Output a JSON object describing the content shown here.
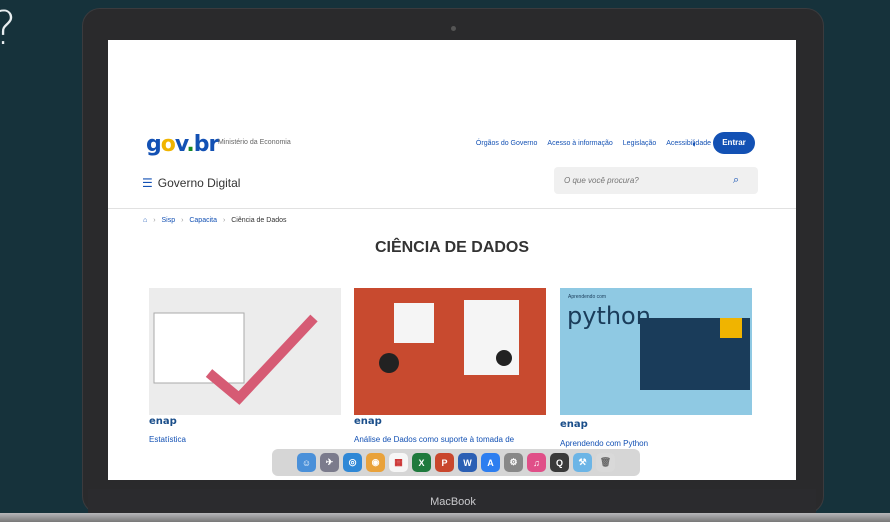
{
  "edge_text": "?\nl",
  "device": {
    "brand": "MacBook"
  },
  "header": {
    "logo": {
      "g": "g",
      "o": "o",
      "v": "v",
      "dot": ".",
      "br": "br"
    },
    "ministry": "Ministério da Economia",
    "links": [
      "Órgãos do Governo",
      "Acesso à informação",
      "Legislação",
      "Acessibilidade"
    ],
    "entrar": "Entrar",
    "menu_title": "Governo Digital",
    "search_placeholder": "O que você procura?"
  },
  "breadcrumb": [
    "Sisp",
    "Capacita",
    "Ciência de Dados"
  ],
  "page_title": "CIÊNCIA DE DADOS",
  "cards": [
    {
      "title": "Estatística",
      "brand": "enap"
    },
    {
      "title": "Análise de Dados como suporte à tomada de",
      "brand": "enap"
    },
    {
      "title": "Aprendendo com Python",
      "brand": "enap",
      "overlay": "python",
      "overlay_small": "Aprendendo com"
    }
  ],
  "dock": [
    "finder",
    "launchpad",
    "safari",
    "chrome",
    "calendar",
    "excel",
    "powerpoint",
    "word",
    "app-store",
    "settings",
    "itunes",
    "quicktime",
    "xcode",
    "trash"
  ],
  "colors": {
    "primary": "#1351b4",
    "background": "#16323b"
  }
}
